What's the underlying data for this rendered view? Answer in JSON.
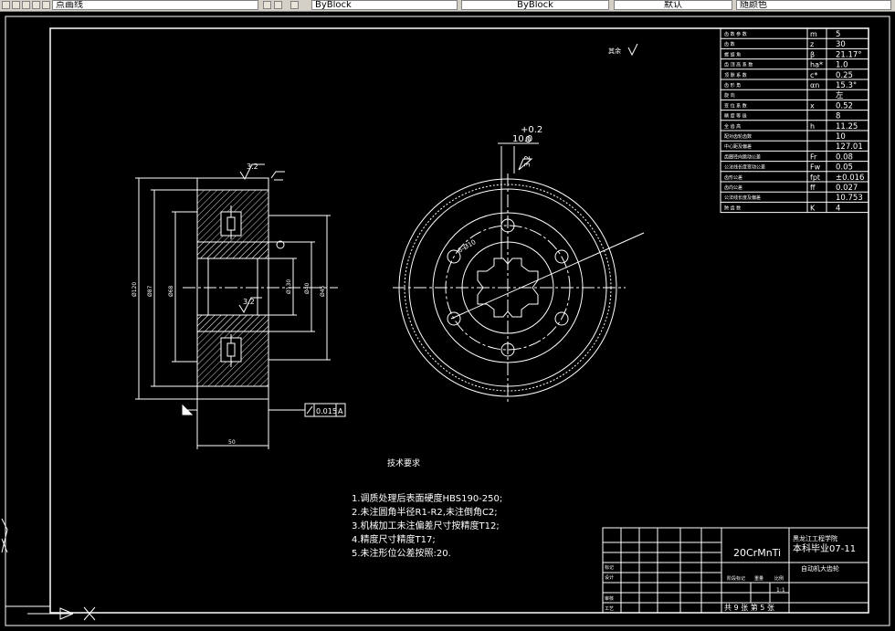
{
  "toolbar": {
    "layer_value": "点画线",
    "linetype_value": "ByBlock",
    "lineweight_value": "ByBlock",
    "plotstyle_value": "默认",
    "extra_value": "随颜色"
  },
  "drawing": {
    "tech_title": "技术要求",
    "tech_notes": [
      "1.调质处理后表面硬度HBS190-250;",
      "2.未注圆角半径R1-R2,未注倒角C2;",
      "3.机械加工未注偏差尺寸按精度T12;",
      "4.精度尺寸精度T17;",
      "5.未注形位公差按照:20."
    ],
    "material": "20CrMnTi",
    "school_line1": "黑龙江工程学院",
    "drawing_no": "本科毕业07-11",
    "part_name": "自动机大齿轮",
    "scale": "1:1",
    "sheet_info": "共 9 张  第 5 张",
    "roughness_top": "3.2",
    "roughness_mid": "3.2",
    "roughness_keyway": "3.2",
    "roughness_other": "其余",
    "tolerance_value": "0.015",
    "datum": "A",
    "keyway_dim": "10.0",
    "keyway_tol": "+0.2",
    "keyway_tol_lower": "0",
    "width_dim": "50",
    "angle_label": "6-Ø10",
    "dia_labels": [
      "Ø120",
      "Ø87",
      "Ø68",
      "Ø45",
      "Ø40",
      "Ø130"
    ],
    "params": [
      {
        "name": "齿 数 参 数",
        "sym": "m",
        "val": "5"
      },
      {
        "name": "齿 数",
        "sym": "z",
        "val": "30"
      },
      {
        "name": "螺 旋 角",
        "sym": "β",
        "val": "21.17°"
      },
      {
        "name": "齿 顶 高 系 数",
        "sym": "ha*",
        "val": "1.0"
      },
      {
        "name": "顶 隙 系 数",
        "sym": "c*",
        "val": "0.25"
      },
      {
        "name": "齿 形 角",
        "sym": "αn",
        "val": "15.3°"
      },
      {
        "name": "旋 向",
        "sym": "",
        "val": "左"
      },
      {
        "name": "变 位 系 数",
        "sym": "x",
        "val": "0.52"
      },
      {
        "name": "精 度 等 级",
        "sym": "",
        "val": "8"
      },
      {
        "name": "全 齿 高",
        "sym": "h",
        "val": "11.25"
      },
      {
        "name": "配对齿轮齿数",
        "sym": "",
        "val": "10"
      },
      {
        "name": "中心距及偏差",
        "sym": "",
        "val": "127.01"
      },
      {
        "name": "齿圈径向跳动公差",
        "sym": "Fr",
        "val": "0.08"
      },
      {
        "name": "公法线长度变动公差",
        "sym": "Fw",
        "val": "0.05"
      },
      {
        "name": "齿形公差",
        "sym": "fpt",
        "val": "±0.016"
      },
      {
        "name": "齿向公差",
        "sym": "ff",
        "val": "0.027"
      },
      {
        "name": "公法线长度及偏差",
        "sym": "",
        "val": "10.753"
      },
      {
        "name": "跨 齿 数",
        "sym": "K",
        "val": "4"
      }
    ],
    "title_block_rows": [
      "标记",
      "设计",
      "审核",
      "工艺"
    ],
    "title_block_cols": [
      "阶段标记",
      "重量",
      "比例"
    ]
  },
  "colors": {
    "line": "#ffffff",
    "hatch": "#ffffff",
    "background": "#000000",
    "toolbar": "#d4d0c8"
  }
}
